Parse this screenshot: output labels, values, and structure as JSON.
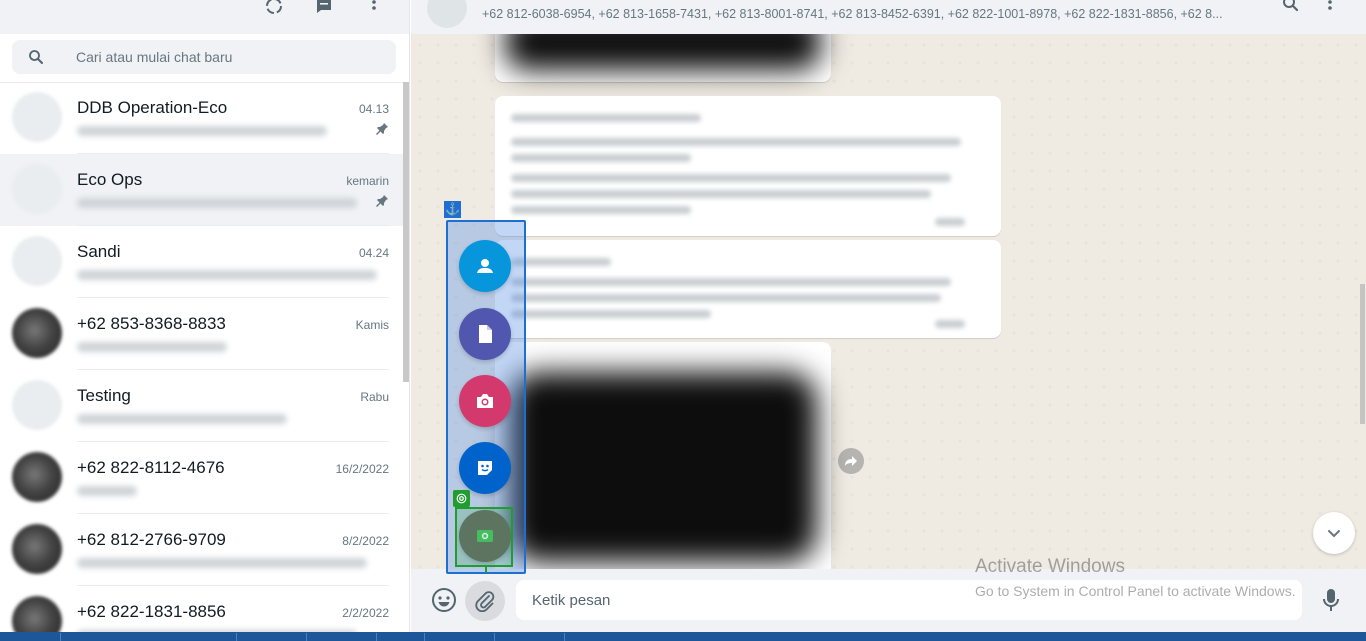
{
  "sidebar": {
    "search_placeholder": "Cari atau mulai chat baru",
    "chats": [
      {
        "name": "DDB Operation-Eco",
        "time": "04.13",
        "pinned": true,
        "avatar": "light"
      },
      {
        "name": "Eco Ops",
        "time": "kemarin",
        "pinned": true,
        "avatar": "light",
        "active": true
      },
      {
        "name": "Sandi",
        "time": "04.24",
        "pinned": false,
        "avatar": "light"
      },
      {
        "name": "+62 853-8368-8833",
        "time": "Kamis",
        "pinned": false,
        "avatar": "dark"
      },
      {
        "name": "Testing",
        "time": "Rabu",
        "pinned": false,
        "avatar": "light"
      },
      {
        "name": "+62 822-8112-4676",
        "time": "16/2/2022",
        "pinned": false,
        "avatar": "dark"
      },
      {
        "name": "+62 812-2766-9709",
        "time": "8/2/2022",
        "pinned": false,
        "avatar": "dark"
      },
      {
        "name": "+62 822-1831-8856",
        "time": "2/2/2022",
        "pinned": false,
        "avatar": "dark"
      }
    ]
  },
  "conversation": {
    "participants": "+62 812-6038-6954, +62 813-1658-7431, +62 813-8001-8741, +62 813-8452-6391, +62 822-1001-8978, +62 822-1831-8856, +62 8...",
    "composer_placeholder": "Ketik pesan"
  },
  "attach_menu": {
    "items": [
      {
        "name": "contact",
        "icon": "person-icon",
        "color": "#0795dc"
      },
      {
        "name": "document",
        "icon": "document-icon",
        "color": "#5157ae"
      },
      {
        "name": "camera",
        "icon": "camera-icon",
        "color": "#d3396d"
      },
      {
        "name": "sticker",
        "icon": "sticker-icon",
        "color": "#0063cb"
      },
      {
        "name": "photos-videos",
        "icon": "image-icon",
        "color": "#6a6a6a"
      }
    ]
  },
  "watermark": {
    "title": "Activate Windows",
    "subtitle": "Go to System in Control Panel to activate Windows."
  },
  "colors": {
    "header_bg": "#f0f2f5",
    "chat_bg": "#efeae2",
    "overlay_blue": "#1f6fd1",
    "overlay_green": "#1f9d2e"
  }
}
